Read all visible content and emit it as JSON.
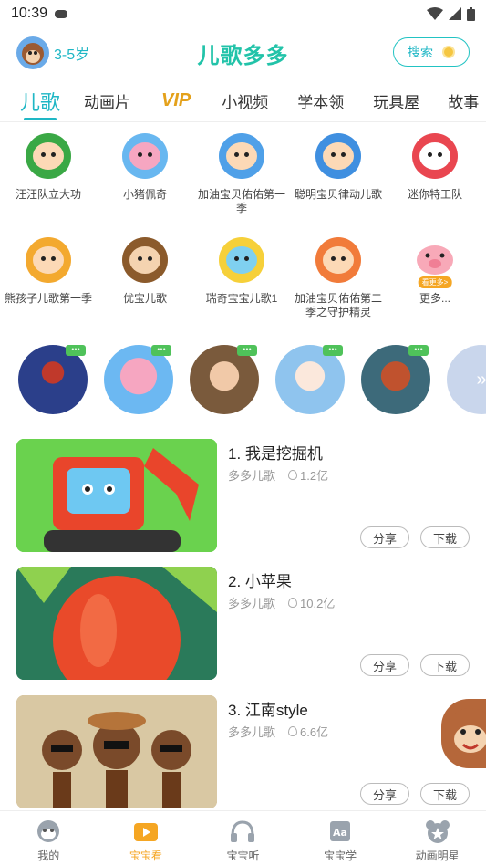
{
  "status": {
    "time": "10:39"
  },
  "header": {
    "age": "3-5岁",
    "logo": "儿歌多多",
    "search": "搜索"
  },
  "tabs": [
    {
      "label": "儿歌",
      "active": true
    },
    {
      "label": "动画片"
    },
    {
      "label": "VIP"
    },
    {
      "label": "小视频"
    },
    {
      "label": "学本领"
    },
    {
      "label": "玩具屋"
    },
    {
      "label": "故事"
    }
  ],
  "characters": [
    {
      "label": "汪汪队立大功",
      "bg": "#3aa845"
    },
    {
      "label": "小猪佩奇",
      "bg": "#68b7f0"
    },
    {
      "label": "加油宝贝佑佑第一季",
      "bg": "#4fa0e8"
    },
    {
      "label": "聪明宝贝律动儿歌",
      "bg": "#3f8fe0"
    },
    {
      "label": "迷你特工队",
      "bg": "#e94650"
    },
    {
      "label": "熊孩子儿歌第一季",
      "bg": "#f3a92f"
    },
    {
      "label": "优宝儿歌",
      "bg": "#8b5a2b"
    },
    {
      "label": "瑞奇宝宝儿歌1",
      "bg": "#f6d03a"
    },
    {
      "label": "加油宝贝佑佑第二季之守护精灵",
      "bg": "#f17b3a"
    },
    {
      "label": "更多...",
      "bg": "#ffffff",
      "badge": "看更多>"
    }
  ],
  "circles": [
    {
      "color": "#2b3f8a",
      "tag": "•••"
    },
    {
      "color": "#6cb8f2",
      "tag": "•••"
    },
    {
      "color": "#7a5a3c",
      "tag": "•••"
    },
    {
      "color": "#8fc4ee",
      "tag": "•••"
    },
    {
      "color": "#3d6a7a",
      "tag": "•••"
    },
    {
      "color": "#c9d6ec"
    }
  ],
  "videos": [
    {
      "title": "1. 我是挖掘机",
      "channel": "多多儿歌",
      "views": "1.2亿",
      "share": "分享",
      "download": "下载",
      "thumb": "#6ad24e"
    },
    {
      "title": "2. 小苹果",
      "channel": "多多儿歌",
      "views": "10.2亿",
      "share": "分享",
      "download": "下载",
      "thumb": "#2a7a5a"
    },
    {
      "title": "3. 江南style",
      "channel": "多多儿歌",
      "views": "6.6亿",
      "share": "分享",
      "download": "下载",
      "thumb": "#c4a57a"
    }
  ],
  "bottom_nav": [
    {
      "label": "我的",
      "icon": "monkey-face-icon"
    },
    {
      "label": "宝宝看",
      "icon": "tv-play-icon",
      "active": true
    },
    {
      "label": "宝宝听",
      "icon": "headphones-icon"
    },
    {
      "label": "宝宝学",
      "icon": "aa-book-icon"
    },
    {
      "label": "动画明星",
      "icon": "bear-star-icon"
    }
  ]
}
